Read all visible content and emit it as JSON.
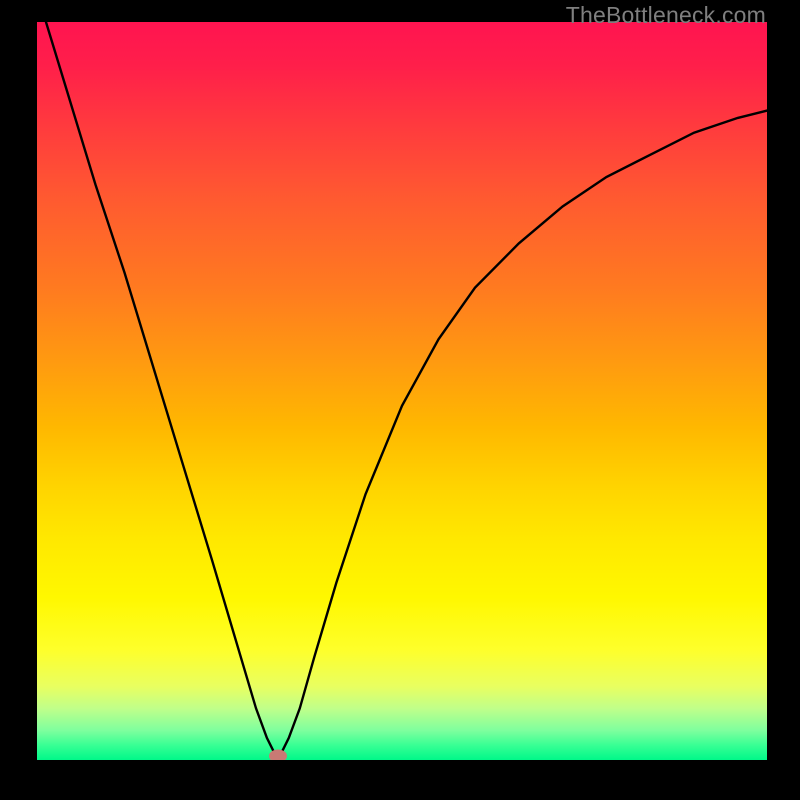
{
  "watermark": "TheBottleneck.com",
  "marker": {
    "x_pct": 33,
    "y_pct": 99.4,
    "color": "#c97a74"
  },
  "chart_data": {
    "type": "line",
    "title": "",
    "xlabel": "",
    "ylabel": "",
    "xlim": [
      0,
      100
    ],
    "ylim": [
      0,
      100
    ],
    "grid": false,
    "legend": false,
    "background": "rainbow-gradient (red top → green bottom)",
    "series": [
      {
        "name": "bottleneck-curve",
        "x": [
          0,
          4,
          8,
          12,
          16,
          20,
          24,
          27,
          30,
          31.5,
          33,
          34.5,
          36,
          38,
          41,
          45,
          50,
          55,
          60,
          66,
          72,
          78,
          84,
          90,
          96,
          100
        ],
        "y": [
          104,
          91,
          78,
          66,
          53,
          40,
          27,
          17,
          7,
          3,
          0,
          3,
          7,
          14,
          24,
          36,
          48,
          57,
          64,
          70,
          75,
          79,
          82,
          85,
          87,
          88
        ]
      }
    ],
    "annotations": [
      {
        "type": "marker",
        "x": 33,
        "y": 0,
        "shape": "ellipse",
        "color": "#c97a74"
      }
    ]
  }
}
